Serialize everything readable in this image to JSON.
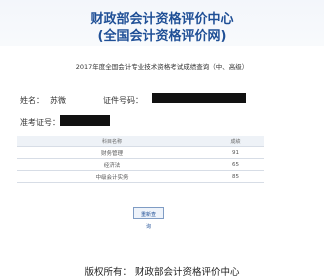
{
  "header": {
    "title_line1": "财政部会计资格评价中心",
    "title_line2": "(全国会计资格评价网)"
  },
  "page_subtitle": "2017年度全国会计专业技术资格考试成绩查询（中、高级）",
  "candidate": {
    "name_label": "姓名：",
    "name_value": "苏微",
    "id_label": "证件号码：",
    "exam_no_label": "准考证号："
  },
  "scores_table": {
    "headers": [
      "科目名称",
      "成绩"
    ],
    "rows": [
      {
        "subject": "财务管理",
        "score": "91"
      },
      {
        "subject": "经济法",
        "score": "65"
      },
      {
        "subject": "中级会计实务",
        "score": "85"
      }
    ]
  },
  "actions": {
    "requery_label": "重新查询"
  },
  "footer": {
    "text": "版权所有：  财政部会计资格评价中心"
  },
  "colors": {
    "title": "#1f4f96",
    "header_bg": "#f3f6fb"
  }
}
